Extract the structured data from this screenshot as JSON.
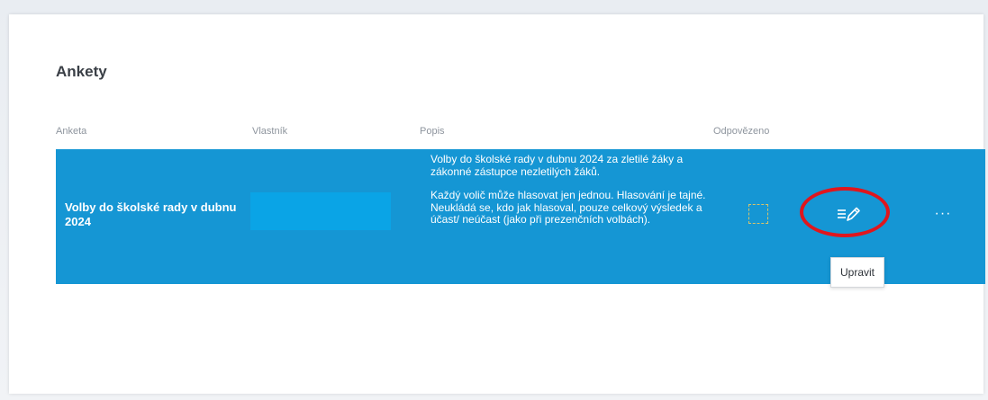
{
  "card": {
    "title": "Ankety"
  },
  "table": {
    "headers": {
      "anketa": "Anketa",
      "vlastnik": "Vlastník",
      "popis": "Popis",
      "odpovezeno": "Odpovězeno"
    },
    "rows": [
      {
        "name": "Volby do školské rady v dubnu 2024",
        "description_p1": "Volby do školské rady v dubnu 2024 za zletilé žáky a zákonné zástupce nezletilých žáků.",
        "description_p2": "Každý volič může hlasovat jen jednou. Hlasování je tajné. Neukládá se, kdo jak hlasoval, pouze celkový výsledek a účast/ neúčast (jako při prezenčních volbách).",
        "answered": false,
        "more_label": "···"
      }
    ]
  },
  "tooltip": {
    "text": "Upravit"
  },
  "icons": {
    "edit": "edit-pencil-icon",
    "more": "more-horizontal-icon"
  },
  "colors": {
    "row_highlight": "#1596d4",
    "owner_box": "#0aa4e6",
    "annotation_ring": "#e0161d"
  }
}
